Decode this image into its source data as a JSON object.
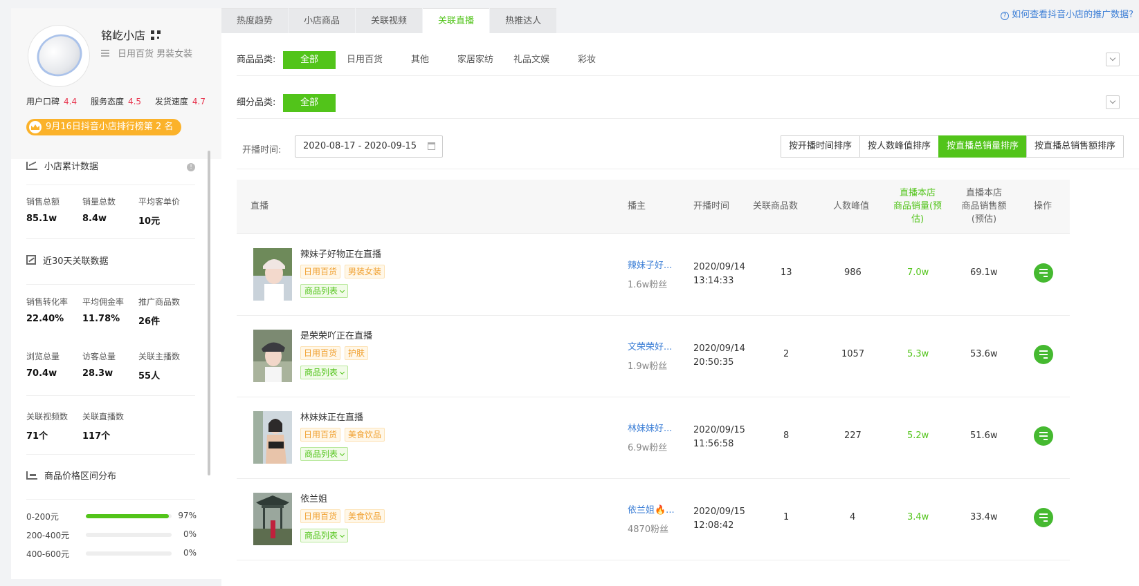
{
  "shop": {
    "name": "铭屹小店",
    "categories": "日用百货 男装女装",
    "ratings": [
      {
        "label": "用户口碑",
        "value": "4.4"
      },
      {
        "label": "服务态度",
        "value": "4.5"
      },
      {
        "label": "发货速度",
        "value": "4.7"
      }
    ],
    "rank_text": "9月16日抖音小店排行榜第 2 名"
  },
  "cumulative": {
    "title": "小店累计数据",
    "stats": [
      {
        "label": "销售总额",
        "value": "85.1w"
      },
      {
        "label": "销量总数",
        "value": "8.4w"
      },
      {
        "label": "平均客单价",
        "value": "10元"
      }
    ]
  },
  "recent30": {
    "title": "近30天关联数据",
    "rows": [
      [
        {
          "label": "销售转化率",
          "value": "22.40%"
        },
        {
          "label": "平均佣金率",
          "value": "11.78%"
        },
        {
          "label": "推广商品数",
          "value": "26件"
        }
      ],
      [
        {
          "label": "浏览总量",
          "value": "70.4w"
        },
        {
          "label": "访客总量",
          "value": "28.3w"
        },
        {
          "label": "关联主播数",
          "value": "55人"
        }
      ],
      [
        {
          "label": "关联视频数",
          "value": "71个"
        },
        {
          "label": "关联直播数",
          "value": "117个"
        }
      ]
    ]
  },
  "price_dist": {
    "title": "商品价格区间分布",
    "rows": [
      {
        "label": "0-200元",
        "percent": "97%",
        "fill": 97
      },
      {
        "label": "200-400元",
        "percent": "0%",
        "fill": 0
      },
      {
        "label": "400-600元",
        "percent": "0%",
        "fill": 0
      }
    ]
  },
  "tabs": [
    "热度趋势",
    "小店商品",
    "关联视频",
    "关联直播",
    "热推达人"
  ],
  "active_tab": 3,
  "help_link": "如何查看抖音小店的推广数据?",
  "filters": {
    "category_label": "商品品类:",
    "categories": [
      "全部",
      "日用百货",
      "其他",
      "家居家纺",
      "礼品文娱",
      "彩妆"
    ],
    "sub_label": "细分品类:",
    "sub_categories": [
      "全部"
    ]
  },
  "date": {
    "label": "开播时间:",
    "range": "2020-08-17 - 2020-09-15"
  },
  "sort_buttons": [
    "按开播时间排序",
    "按人数峰值排序",
    "按直播总销量排序",
    "按直播总销售额排序"
  ],
  "active_sort": 2,
  "table": {
    "headers": {
      "live": "直播",
      "anchor": "播主",
      "time": "开播时间",
      "goods_count": "关联商品数",
      "peak": "人数峰值",
      "sales_line1": "直播本店",
      "sales_line2": "商品销量(预",
      "sales_line3": "估)",
      "amount_line1": "直播本店",
      "amount_line2": "商品销售额",
      "amount_line3": "(预估)",
      "op": "操作"
    },
    "goods_list_label": "商品列表",
    "rows": [
      {
        "title": "辣妹子好物正在直播",
        "tags": [
          "日用百货",
          "男装女装"
        ],
        "anchor": "辣妹子好...",
        "fans": "1.6w粉丝",
        "date": "2020/09/14",
        "clock": "13:14:33",
        "goods": "13",
        "peak": "986",
        "sales": "7.0w",
        "amount": "69.1w"
      },
      {
        "title": "是荣荣吖正在直播",
        "tags": [
          "日用百货",
          "护肤"
        ],
        "anchor": "文荣荣好...",
        "fans": "1.9w粉丝",
        "date": "2020/09/14",
        "clock": "20:50:35",
        "goods": "2",
        "peak": "1057",
        "sales": "5.3w",
        "amount": "53.6w"
      },
      {
        "title": "林妹妹正在直播",
        "tags": [
          "日用百货",
          "美食饮品"
        ],
        "anchor": "林妹妹好...",
        "fans": "6.9w粉丝",
        "date": "2020/09/15",
        "clock": "11:56:58",
        "goods": "8",
        "peak": "227",
        "sales": "5.2w",
        "amount": "51.6w"
      },
      {
        "title": "依兰姐",
        "tags": [
          "日用百货",
          "美食饮品"
        ],
        "anchor": "依兰姐🔥...",
        "fans": "4870粉丝",
        "date": "2020/09/15",
        "clock": "12:08:42",
        "goods": "1",
        "peak": "4",
        "sales": "3.4w",
        "amount": "33.4w"
      }
    ]
  },
  "colors": {
    "accent": "#52c41a",
    "link": "#3d7fd6",
    "rating": "#e8364f",
    "badge": "#fbb22a"
  }
}
